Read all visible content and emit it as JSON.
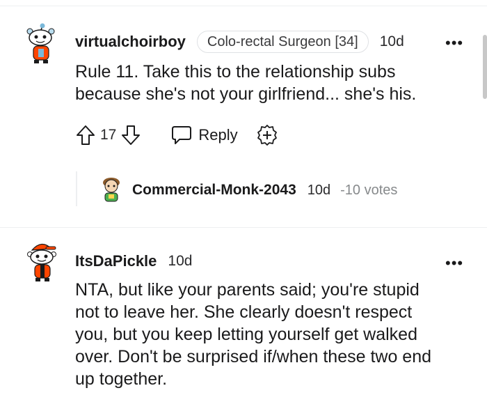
{
  "comments": [
    {
      "username": "virtualchoirboy",
      "flair": "Colo-rectal Surgeon [34]",
      "time": "10d",
      "more": "•••",
      "lines": [
        "Rule 11. Take this to the relationship subs",
        "because she's not your girlfriend... she's his."
      ],
      "votes": "17",
      "reply_label": "Reply"
    },
    {
      "username": "ItsDaPickle",
      "time": "10d",
      "more": "•••",
      "lines": [
        "NTA, but like your parents said; you're stupid",
        "not to leave her. She clearly doesn't respect",
        "you, but you keep letting yourself get walked",
        "over. Don't be surprised if/when these two end",
        "up together."
      ]
    }
  ],
  "collapsed_reply": {
    "username": "Commercial-Monk-2043",
    "time": "10d",
    "votes_text": "-10 votes"
  },
  "colors": {
    "orangered": "#ff4500",
    "text": "#1a1a1b",
    "muted": "#878a8c"
  }
}
